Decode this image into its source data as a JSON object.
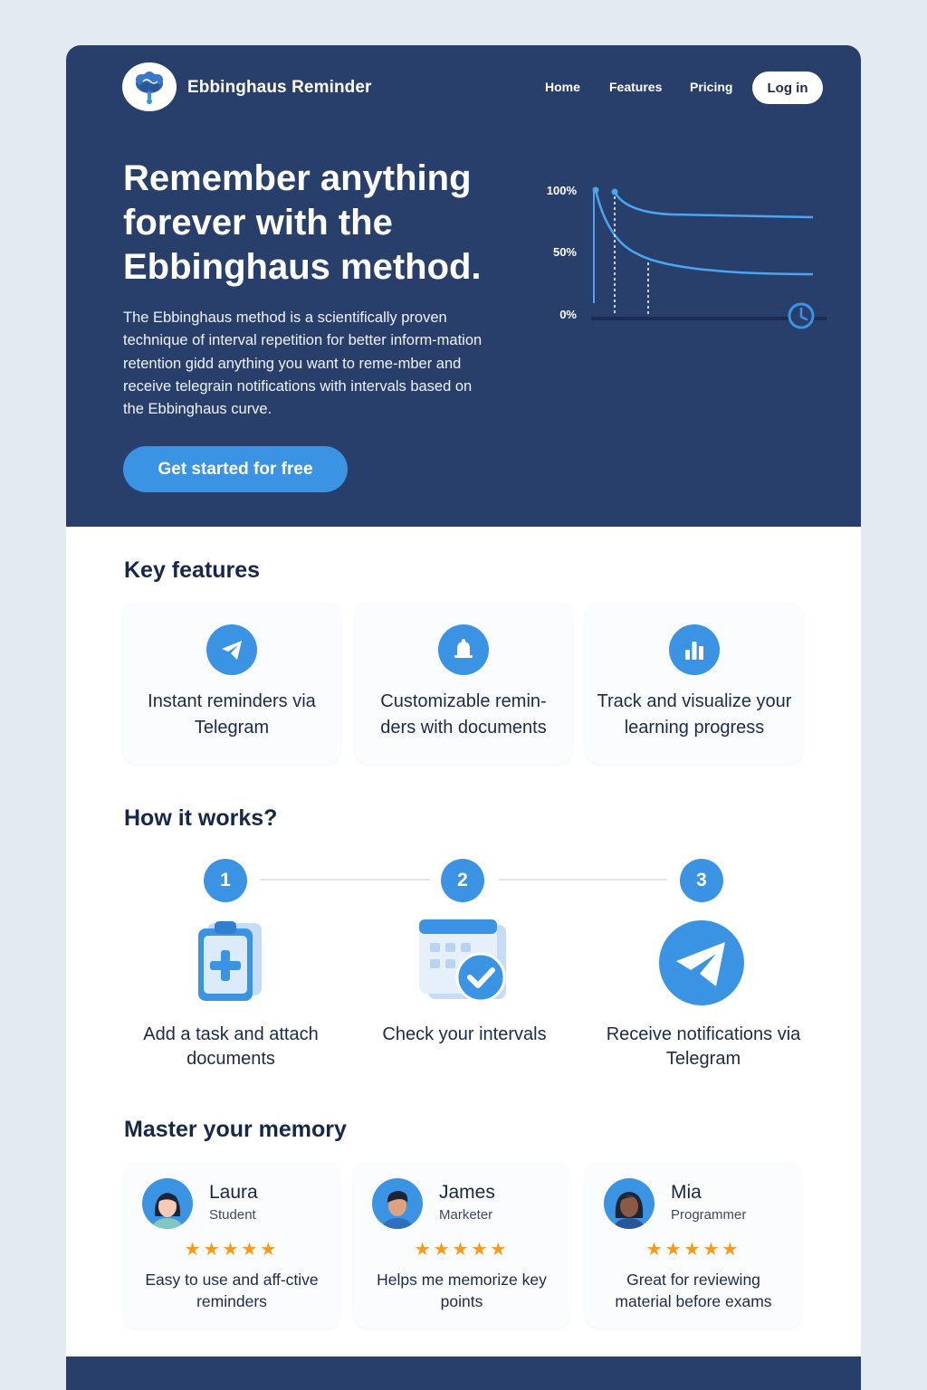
{
  "header": {
    "brand": "Ebbinghaus Reminder",
    "logo_icon": "brain-icon",
    "nav": [
      "Home",
      "Features",
      "Pricing"
    ],
    "login_label": "Log in"
  },
  "hero": {
    "title": "Remember anything forever with the Ebbinghaus method.",
    "description": "The Ebbinghaus method is a scientifically proven technique of interval repetition for better inform-mation retention gidd anything you want to reme-mber and receive telegrain notifications with intervals based on the Ebbinghaus curve.",
    "cta_label": "Get started for free",
    "curve": {
      "y_labels": [
        "100%",
        "50%",
        "0%"
      ],
      "clock_icon": "clock-icon"
    }
  },
  "features": {
    "title": "Key features",
    "items": [
      {
        "icon": "telegram-icon",
        "label": "Instant reminders via Telegram"
      },
      {
        "icon": "bell-icon",
        "label": "Customizable remin-ders with documents"
      },
      {
        "icon": "bar-chart-icon",
        "label": "Track and visualize your learning progress"
      }
    ]
  },
  "how": {
    "title": "How it works?",
    "steps": [
      {
        "num": "1",
        "icon": "clipboard-add-icon",
        "label": "Add a task and attach documents"
      },
      {
        "num": "2",
        "icon": "calendar-check-icon",
        "label": "Check your intervals"
      },
      {
        "num": "3",
        "icon": "telegram-icon",
        "label": "Receive notifications via Telegram"
      }
    ]
  },
  "reviews": {
    "title": "Master your memory",
    "items": [
      {
        "name": "Laura",
        "role": "Student",
        "rating": 5,
        "stars": "★★★★★",
        "text": "Easy to use and aff-ctive reminders"
      },
      {
        "name": "James",
        "role": "Marketer",
        "rating": 5,
        "stars": "★★★★★",
        "text": "Helps me memorize key points"
      },
      {
        "name": "Mia",
        "role": "Programmer",
        "rating": 5,
        "stars": "★★★★★",
        "text": "Great for reviewing material before exams"
      }
    ]
  },
  "colors": {
    "hero_bg": "#283f6c",
    "accent": "#3a94e3",
    "star": "#f59b1a",
    "text_dark": "#16284a"
  }
}
